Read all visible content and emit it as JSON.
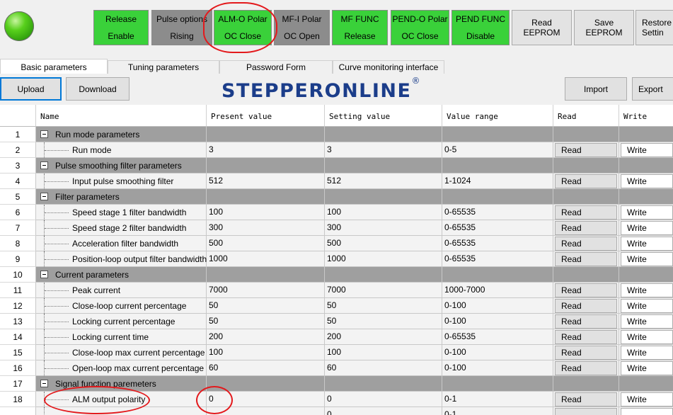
{
  "toolbar": {
    "buttons": [
      {
        "line1": "Release",
        "line2": "Enable"
      },
      {
        "line1": "Pulse options",
        "line2": "Rising"
      },
      {
        "line1": "ALM-O Polar",
        "line2": "OC Close"
      },
      {
        "line1": "MF-I Polar",
        "line2": "OC Open"
      },
      {
        "line1": "MF FUNC",
        "line2": "Release"
      },
      {
        "line1": "PEND-O Polar",
        "line2": "OC Close"
      },
      {
        "line1": "PEND FUNC",
        "line2": "Disable"
      }
    ],
    "read_eeprom": {
      "line1": "Read",
      "line2": "EEPROM"
    },
    "save_eeprom": {
      "line1": "Save",
      "line2": "EEPROM"
    },
    "restore": {
      "line1": "Restore F",
      "line2": "Settin"
    }
  },
  "tabs": [
    "Basic parameters",
    "Tuning parameters",
    "Password Form",
    "Curve monitoring interface"
  ],
  "actions": {
    "upload": "Upload",
    "download": "Download",
    "import": "Import",
    "export": "Export"
  },
  "logo": {
    "text": "STEPPERONLINE",
    "mark": "®"
  },
  "table": {
    "headers": [
      "Name",
      "Present value",
      "Setting value",
      "Value range",
      "Read",
      "Write"
    ],
    "rows": [
      {
        "num": "1",
        "label": "Run mode parameters"
      },
      {
        "num": "2",
        "label": "Run mode",
        "present": "3",
        "setting": "3",
        "range": "0-5",
        "read": "Read",
        "write": "Write"
      },
      {
        "num": "3",
        "label": "Pulse smoothing filter parameters"
      },
      {
        "num": "4",
        "label": "Input pulse smoothing filter",
        "present": "512",
        "setting": "512",
        "range": "1-1024",
        "read": "Read",
        "write": "Write"
      },
      {
        "num": "5",
        "label": "Filter parameters"
      },
      {
        "num": "6",
        "label": "Speed stage 1 filter bandwidth",
        "present": "100",
        "setting": "100",
        "range": "0-65535",
        "read": "Read",
        "write": "Write"
      },
      {
        "num": "7",
        "label": "Speed stage 2 filter bandwidth",
        "present": "300",
        "setting": "300",
        "range": "0-65535",
        "read": "Read",
        "write": "Write"
      },
      {
        "num": "8",
        "label": "Acceleration filter bandwidth",
        "present": "500",
        "setting": "500",
        "range": "0-65535",
        "read": "Read",
        "write": "Write"
      },
      {
        "num": "9",
        "label": "Position-loop output filter bandwidth",
        "present": "1000",
        "setting": "1000",
        "range": "0-65535",
        "read": "Read",
        "write": "Write"
      },
      {
        "num": "10",
        "label": "Current parameters"
      },
      {
        "num": "11",
        "label": "Peak current",
        "present": "7000",
        "setting": "7000",
        "range": "1000-7000",
        "read": "Read",
        "write": "Write"
      },
      {
        "num": "12",
        "label": "Close-loop current percentage",
        "present": "50",
        "setting": "50",
        "range": "0-100",
        "read": "Read",
        "write": "Write"
      },
      {
        "num": "13",
        "label": "Locking current percentage",
        "present": "50",
        "setting": "50",
        "range": "0-100",
        "read": "Read",
        "write": "Write"
      },
      {
        "num": "14",
        "label": "Locking current time",
        "present": "200",
        "setting": "200",
        "range": "0-65535",
        "read": "Read",
        "write": "Write"
      },
      {
        "num": "15",
        "label": "Close-loop max current percentage",
        "present": "100",
        "setting": "100",
        "range": "0-100",
        "read": "Read",
        "write": "Write"
      },
      {
        "num": "16",
        "label": "Open-loop max current percentage",
        "present": "60",
        "setting": "60",
        "range": "0-100",
        "read": "Read",
        "write": "Write"
      },
      {
        "num": "17",
        "label": "Signal function paremeters"
      },
      {
        "num": "18",
        "label": "ALM output polarity",
        "present": "0",
        "setting": "0",
        "range": "0-1",
        "read": "Read",
        "write": "Write"
      },
      {
        "num": "",
        "label": "",
        "present": "",
        "setting": "0",
        "range": "0-1",
        "read": "",
        "write": ""
      }
    ]
  },
  "colors": {
    "toolbar_green": "#3ad13a",
    "toolbar_gray": "#8c8c8c",
    "group_row": "#9f9f9f",
    "annotation_red": "#e3191c",
    "logo_blue": "#1b3d8a"
  }
}
